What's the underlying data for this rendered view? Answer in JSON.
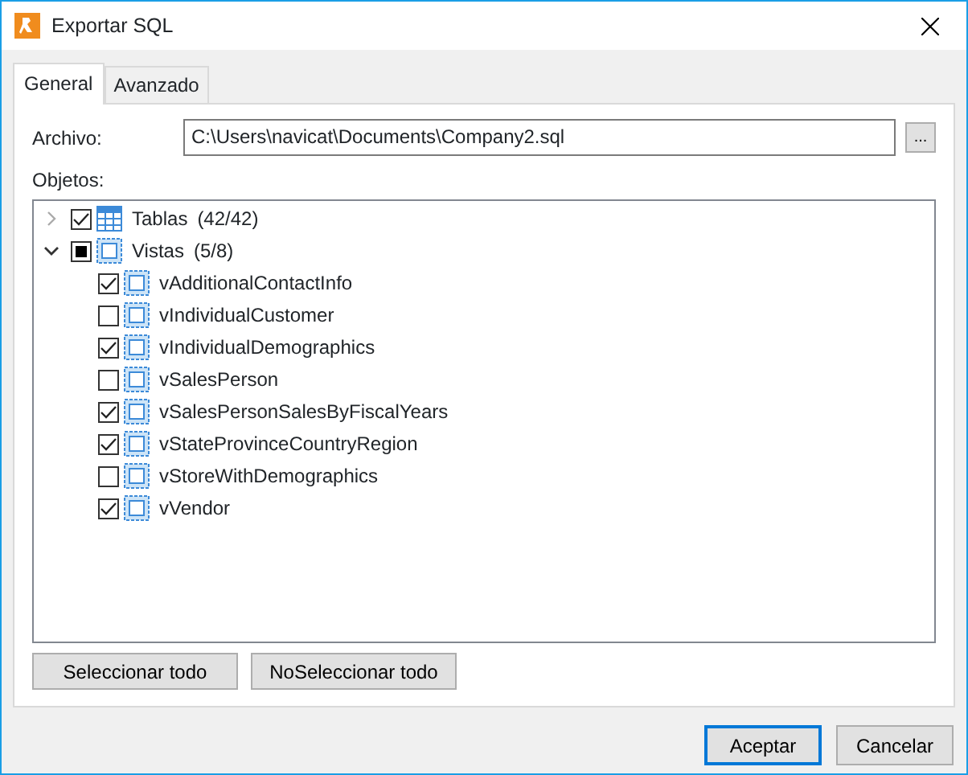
{
  "window": {
    "title": "Exportar SQL"
  },
  "tabs": [
    {
      "label": "General",
      "selected": true
    },
    {
      "label": "Avanzado",
      "selected": false
    }
  ],
  "file": {
    "label": "Archivo:",
    "value": "C:\\Users\\navicat\\Documents\\Company2.sql",
    "browse": "..."
  },
  "objects_label": "Objetos:",
  "tree": [
    {
      "kind": "table",
      "label": "Tablas",
      "count": "(42/42)",
      "expanded": false,
      "checked": true,
      "partial": false
    },
    {
      "kind": "view",
      "label": "Vistas",
      "count": "(5/8)",
      "expanded": true,
      "checked": false,
      "partial": true,
      "children": [
        {
          "kind": "view",
          "label": "vAdditionalContactInfo",
          "checked": true
        },
        {
          "kind": "view",
          "label": "vIndividualCustomer",
          "checked": false
        },
        {
          "kind": "view",
          "label": "vIndividualDemographics",
          "checked": true
        },
        {
          "kind": "view",
          "label": "vSalesPerson",
          "checked": false
        },
        {
          "kind": "view",
          "label": "vSalesPersonSalesByFiscalYears",
          "checked": true
        },
        {
          "kind": "view",
          "label": "vStateProvinceCountryRegion",
          "checked": true
        },
        {
          "kind": "view",
          "label": "vStoreWithDemographics",
          "checked": false
        },
        {
          "kind": "view",
          "label": "vVendor",
          "checked": true
        }
      ]
    }
  ],
  "select_buttons": [
    "Seleccionar todo",
    "NoSeleccionar todo"
  ],
  "buttons": [
    {
      "label": "Aceptar",
      "default": true
    },
    {
      "label": "Cancelar",
      "default": false
    }
  ]
}
